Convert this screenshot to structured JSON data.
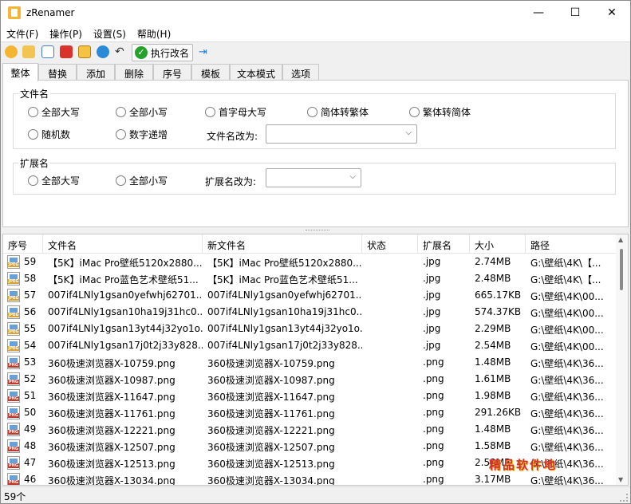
{
  "window": {
    "title": "zRenamer",
    "min": "—",
    "max": "☐",
    "close": "✕"
  },
  "menu": [
    "文件(F)",
    "操作(P)",
    "设置(S)",
    "帮助(H)"
  ],
  "toolbar": {
    "execute_label": "执行改名"
  },
  "tabs": [
    "整体",
    "替换",
    "添加",
    "删除",
    "序号",
    "模板",
    "文本模式",
    "选项"
  ],
  "filename_group": {
    "title": "文件名",
    "options": [
      "全部大写",
      "全部小写",
      "首字母大写",
      "简体转繁体",
      "繁体转简体",
      "随机数",
      "数字递增"
    ],
    "change_to_label": "文件名改为:",
    "change_to_value": ""
  },
  "ext_group": {
    "title": "扩展名",
    "options": [
      "全部大写",
      "全部小写"
    ],
    "change_to_label": "扩展名改为:",
    "change_to_value": ""
  },
  "list": {
    "columns": [
      "序号",
      "文件名",
      "新文件名",
      "状态",
      "扩展名",
      "大小",
      "路径"
    ],
    "rows": [
      {
        "type": "JPEG",
        "seq": "59",
        "name": "【5K】iMac Pro壁纸5120x2880...",
        "new_name": "【5K】iMac Pro壁纸5120x2880...",
        "status": "",
        "ext": ".jpg",
        "size": "2.74MB",
        "path": "G:\\壁纸\\4K\\【..."
      },
      {
        "type": "JPEG",
        "seq": "58",
        "name": "【5K】iMac Pro蓝色艺术壁纸51...",
        "new_name": "【5K】iMac Pro蓝色艺术壁纸51...",
        "status": "",
        "ext": ".jpg",
        "size": "2.48MB",
        "path": "G:\\壁纸\\4K\\【..."
      },
      {
        "type": "JPEG",
        "seq": "57",
        "name": "007if4LNly1gsan0yefwhj62701...",
        "new_name": "007if4LNly1gsan0yefwhj62701...",
        "status": "",
        "ext": ".jpg",
        "size": "665.17KB",
        "path": "G:\\壁纸\\4K\\00..."
      },
      {
        "type": "JPEG",
        "seq": "56",
        "name": "007if4LNly1gsan10ha19j31hc0...",
        "new_name": "007if4LNly1gsan10ha19j31hc0...",
        "status": "",
        "ext": ".jpg",
        "size": "574.37KB",
        "path": "G:\\壁纸\\4K\\00..."
      },
      {
        "type": "JPEG",
        "seq": "55",
        "name": "007if4LNly1gsan13yt44j32yo1o...",
        "new_name": "007if4LNly1gsan13yt44j32yo1o...",
        "status": "",
        "ext": ".jpg",
        "size": "2.29MB",
        "path": "G:\\壁纸\\4K\\00..."
      },
      {
        "type": "JPEG",
        "seq": "54",
        "name": "007if4LNly1gsan17j0t2j33y828...",
        "new_name": "007if4LNly1gsan17j0t2j33y828...",
        "status": "",
        "ext": ".jpg",
        "size": "2.54MB",
        "path": "G:\\壁纸\\4K\\00..."
      },
      {
        "type": "PNG",
        "seq": "53",
        "name": "360极速浏览器X-10759.png",
        "new_name": "360极速浏览器X-10759.png",
        "status": "",
        "ext": ".png",
        "size": "1.48MB",
        "path": "G:\\壁纸\\4K\\36..."
      },
      {
        "type": "PNG",
        "seq": "52",
        "name": "360极速浏览器X-10987.png",
        "new_name": "360极速浏览器X-10987.png",
        "status": "",
        "ext": ".png",
        "size": "1.61MB",
        "path": "G:\\壁纸\\4K\\36..."
      },
      {
        "type": "PNG",
        "seq": "51",
        "name": "360极速浏览器X-11647.png",
        "new_name": "360极速浏览器X-11647.png",
        "status": "",
        "ext": ".png",
        "size": "1.98MB",
        "path": "G:\\壁纸\\4K\\36..."
      },
      {
        "type": "PNG",
        "seq": "50",
        "name": "360极速浏览器X-11761.png",
        "new_name": "360极速浏览器X-11761.png",
        "status": "",
        "ext": ".png",
        "size": "291.26KB",
        "path": "G:\\壁纸\\4K\\36..."
      },
      {
        "type": "PNG",
        "seq": "49",
        "name": "360极速浏览器X-12221.png",
        "new_name": "360极速浏览器X-12221.png",
        "status": "",
        "ext": ".png",
        "size": "1.48MB",
        "path": "G:\\壁纸\\4K\\36..."
      },
      {
        "type": "PNG",
        "seq": "48",
        "name": "360极速浏览器X-12507.png",
        "new_name": "360极速浏览器X-12507.png",
        "status": "",
        "ext": ".png",
        "size": "1.58MB",
        "path": "G:\\壁纸\\4K\\36..."
      },
      {
        "type": "PNG",
        "seq": "47",
        "name": "360极速浏览器X-12513.png",
        "new_name": "360极速浏览器X-12513.png",
        "status": "",
        "ext": ".png",
        "size": "2.53MB",
        "path": "G:\\壁纸\\4K\\36..."
      },
      {
        "type": "PNG",
        "seq": "46",
        "name": "360极速浏览器X-13034.png",
        "new_name": "360极速浏览器X-13034.png",
        "status": "",
        "ext": ".png",
        "size": "3.17MB",
        "path": "G:\\壁纸\\4K\\36..."
      }
    ]
  },
  "watermark": "精品软件地",
  "status": {
    "count": "59个"
  }
}
